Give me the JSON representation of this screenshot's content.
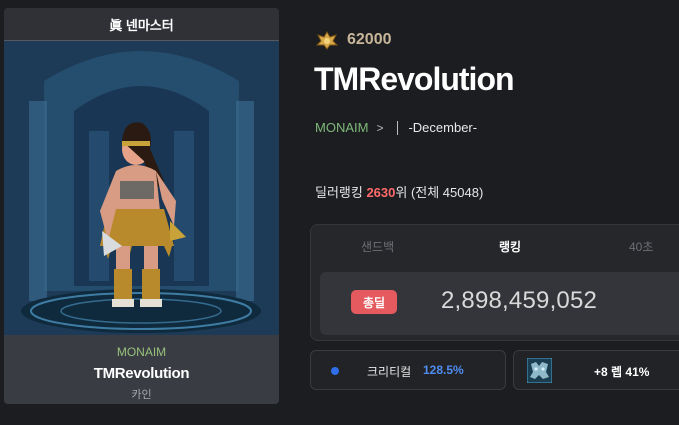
{
  "card": {
    "header": "眞 넨마스터",
    "guild": "MONAIM",
    "name": "TMRevolution",
    "class": "카인"
  },
  "profile": {
    "fame_icon": "fame-crest-icon",
    "fame": "62000",
    "name": "TMRevolution",
    "guild": "MONAIM",
    "chevron": ">",
    "adventure": "-December-",
    "rank_prefix": "딜러랭킹 ",
    "rank_number": "2630",
    "rank_suffix": "위 (전체 45048)"
  },
  "ranking": {
    "tabs": [
      "샌드백",
      "랭킹",
      "40초"
    ],
    "active_tab": "랭킹",
    "total_badge": "총딜",
    "total_value": "2,898,459,052"
  },
  "stats": {
    "crit_label": "크리티컬",
    "crit_value": "128.5%",
    "item_icon": "item-portrait-icon",
    "item_value": "+8 렙 41%"
  },
  "colors": {
    "accent_red": "#e45a5e",
    "accent_blue": "#2f6ee8",
    "guild_green": "#7fb87a"
  }
}
